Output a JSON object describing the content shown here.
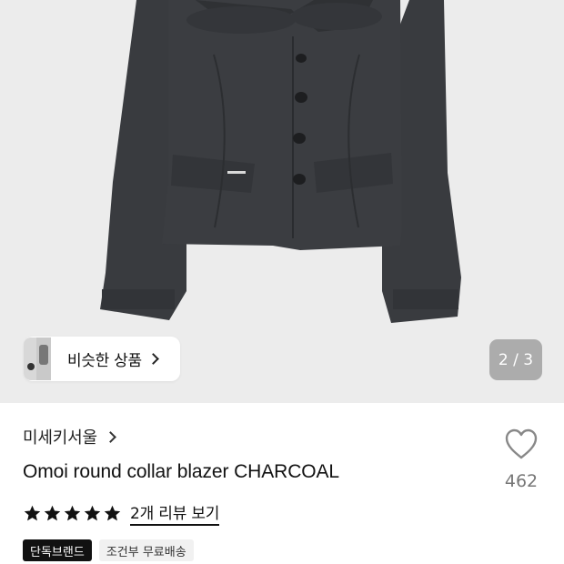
{
  "gallery": {
    "page_indicator": "2 / 3",
    "similar_products_label": "비슷한 상품"
  },
  "product": {
    "brand": "미세키서울",
    "title": "Omoi round collar blazer CHARCOAL",
    "like_count": "462",
    "rating_stars": 5,
    "review_link": "2개 리뷰 보기",
    "badges": [
      "단독브랜드",
      "조건부 무료배송"
    ]
  },
  "colors": {
    "background_gray": "#ececec",
    "blazer": "#3a3c40",
    "badge_dark": "#111111",
    "badge_light": "#f1f1f1",
    "like_count": "#777777"
  },
  "icons": {
    "similar_chevron": "chevron-right-icon",
    "brand_chevron": "chevron-right-icon",
    "like": "heart-outline-icon",
    "star": "star-filled-icon"
  }
}
